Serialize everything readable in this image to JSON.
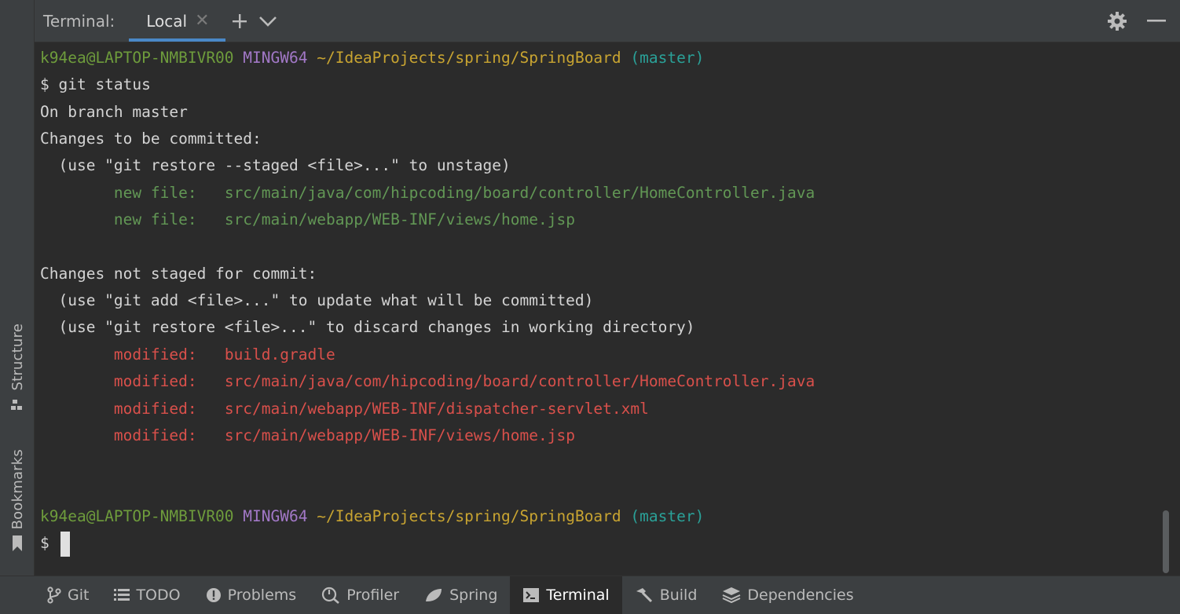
{
  "header": {
    "title": "Terminal:",
    "tab_label": "Local",
    "add_icon": "plus-icon",
    "dropdown_icon": "chevron-down-icon",
    "settings_icon": "gear-icon",
    "minimize_icon": "minimize-icon"
  },
  "left_stripe": {
    "structure_label": "Structure",
    "bookmarks_label": "Bookmarks"
  },
  "terminal": {
    "prompt1": {
      "user": "k94ea@LAPTOP-NMBIVR00",
      "env": "MINGW64",
      "path": "~/IdeaProjects/spring/SpringBoard",
      "branch": "(master)"
    },
    "command": "$ git status",
    "on_branch": "On branch master",
    "staged_header": "Changes to be committed:",
    "staged_hint": "  (use \"git restore --staged <file>...\" to unstage)",
    "staged_files": [
      {
        "status": "new file:",
        "path": "src/main/java/com/hipcoding/board/controller/HomeController.java"
      },
      {
        "status": "new file:",
        "path": "src/main/webapp/WEB-INF/views/home.jsp"
      }
    ],
    "unstaged_header": "Changes not staged for commit:",
    "unstaged_hint1": "  (use \"git add <file>...\" to update what will be committed)",
    "unstaged_hint2": "  (use \"git restore <file>...\" to discard changes in working directory)",
    "modified_files": [
      {
        "status": "modified:",
        "path": "build.gradle"
      },
      {
        "status": "modified:",
        "path": "src/main/java/com/hipcoding/board/controller/HomeController.java"
      },
      {
        "status": "modified:",
        "path": "src/main/webapp/WEB-INF/dispatcher-servlet.xml"
      },
      {
        "status": "modified:",
        "path": "src/main/webapp/WEB-INF/views/home.jsp"
      }
    ],
    "prompt2": {
      "user": "k94ea@LAPTOP-NMBIVR00",
      "env": "MINGW64",
      "path": "~/IdeaProjects/spring/SpringBoard",
      "branch": "(master)"
    },
    "prompt_symbol": "$"
  },
  "bottom_tools": [
    {
      "label": "Git",
      "icon": "git-branch-icon"
    },
    {
      "label": "TODO",
      "icon": "todo-list-icon"
    },
    {
      "label": "Problems",
      "icon": "problems-icon"
    },
    {
      "label": "Profiler",
      "icon": "profiler-icon"
    },
    {
      "label": "Spring",
      "icon": "spring-leaf-icon"
    },
    {
      "label": "Terminal",
      "icon": "terminal-icon",
      "active": true
    },
    {
      "label": "Build",
      "icon": "hammer-icon"
    },
    {
      "label": "Dependencies",
      "icon": "layers-icon"
    }
  ],
  "colors": {
    "background": "#2b2b2b",
    "panel": "#3c3f41",
    "accent_tab": "#4a88c7",
    "prompt_user": "#6e9c3c",
    "prompt_env": "#a278c7",
    "prompt_path": "#c8a431",
    "prompt_branch": "#2aa198",
    "new_file": "#629755",
    "modified": "#d9504b"
  }
}
